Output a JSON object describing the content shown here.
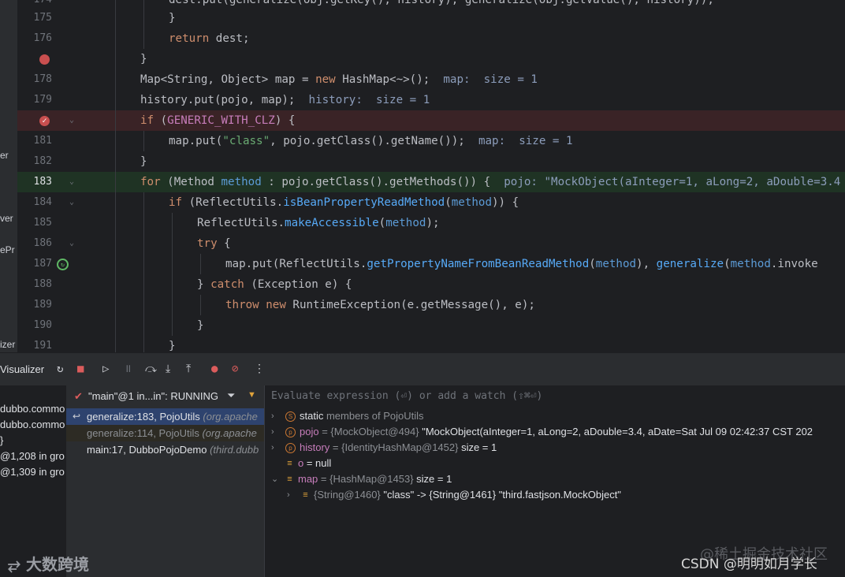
{
  "left_panel_fragments": [
    "er",
    "ver",
    "ePr",
    "izer"
  ],
  "editor": {
    "lines": [
      {
        "num": "174",
        "parts": [
          [
            "pl",
            "dest.put(generalize(obj.getKey(), history), generalize(obj.getValue(), history));"
          ]
        ]
      },
      {
        "num": "175",
        "parts": [
          [
            "pl",
            "}"
          ]
        ]
      },
      {
        "num": "176",
        "parts": [
          [
            "kw",
            "return "
          ],
          [
            "pl",
            "dest;"
          ]
        ]
      },
      {
        "num": "",
        "parts": [
          [
            "pl",
            "}"
          ]
        ]
      },
      {
        "num": "178",
        "parts": [
          [
            "pl",
            "Map<String, Object> map = "
          ],
          [
            "kw",
            "new "
          ],
          [
            "pl",
            "HashMap<~>();"
          ],
          [
            "inl",
            "  map:  size = 1"
          ]
        ]
      },
      {
        "num": "179",
        "parts": [
          [
            "pl",
            "history.put(pojo, map);"
          ],
          [
            "inl",
            "  history:  size = 1"
          ]
        ]
      },
      {
        "num": "",
        "parts": [
          [
            "kw",
            "if "
          ],
          [
            "pl",
            "("
          ],
          [
            "cst",
            "GENERIC_WITH_CLZ"
          ],
          [
            "pl",
            ") {"
          ]
        ]
      },
      {
        "num": "181",
        "parts": [
          [
            "pl",
            "map.put("
          ],
          [
            "str",
            "\"class\""
          ],
          [
            "pl",
            ", pojo.getClass().getName());"
          ],
          [
            "inl",
            "  map:  size = 1"
          ]
        ]
      },
      {
        "num": "182",
        "parts": [
          [
            "pl",
            "}"
          ]
        ]
      },
      {
        "num": "183",
        "parts": [
          [
            "kw",
            "for "
          ],
          [
            "pl",
            "(Method "
          ],
          [
            "param",
            "method"
          ],
          [
            "pl",
            " : pojo.getClass().getMethods()) {"
          ],
          [
            "inl",
            "  pojo: \"MockObject(aInteger=1, aLong=2, aDouble=3.4"
          ]
        ]
      },
      {
        "num": "184",
        "parts": [
          [
            "kw",
            "if "
          ],
          [
            "pl",
            "(ReflectUtils."
          ],
          [
            "fn",
            "isBeanPropertyReadMethod"
          ],
          [
            "pl",
            "("
          ],
          [
            "param",
            "method"
          ],
          [
            "pl",
            ")) {"
          ]
        ]
      },
      {
        "num": "185",
        "parts": [
          [
            "pl",
            "ReflectUtils."
          ],
          [
            "fn",
            "makeAccessible"
          ],
          [
            "pl",
            "("
          ],
          [
            "param",
            "method"
          ],
          [
            "pl",
            ");"
          ]
        ]
      },
      {
        "num": "186",
        "parts": [
          [
            "kw",
            "try "
          ],
          [
            "pl",
            "{"
          ]
        ]
      },
      {
        "num": "187",
        "parts": [
          [
            "pl",
            "map.put(ReflectUtils."
          ],
          [
            "fn",
            "getPropertyNameFromBeanReadMethod"
          ],
          [
            "pl",
            "("
          ],
          [
            "param",
            "method"
          ],
          [
            "pl",
            "), "
          ],
          [
            "fn",
            "generalize"
          ],
          [
            "pl",
            "("
          ],
          [
            "param",
            "method"
          ],
          [
            "pl",
            ".invoke"
          ]
        ]
      },
      {
        "num": "188",
        "parts": [
          [
            "pl",
            "} "
          ],
          [
            "kw",
            "catch "
          ],
          [
            "pl",
            "(Exception e) {"
          ]
        ]
      },
      {
        "num": "189",
        "parts": [
          [
            "kw",
            "throw new "
          ],
          [
            "pl",
            "RuntimeException(e.getMessage(), e);"
          ]
        ]
      },
      {
        "num": "190",
        "parts": [
          [
            "pl",
            "}"
          ]
        ]
      },
      {
        "num": "191",
        "parts": [
          [
            "pl",
            "}"
          ]
        ]
      }
    ]
  },
  "toolbar": {
    "title": "Visualizer",
    "icons": [
      "rerun-icon",
      "stop-icon",
      "resume-icon",
      "pause-icon",
      "step-over-icon",
      "step-into-icon",
      "step-out-icon",
      "view-breakpoints-icon",
      "mute-breakpoints-icon",
      "more-icon"
    ]
  },
  "left_list": [
    "dubbo.commo",
    "dubbo.commo",
    "}",
    "@1,208 in gro",
    "@1,309 in gro"
  ],
  "thread": {
    "label": "\"main\"@1 in...in\": RUNNING"
  },
  "frames": [
    {
      "text": "generalize:183, PojoUtils ",
      "pkg": "(org.apache",
      "selected": true
    },
    {
      "text": "generalize:114, PojoUtils ",
      "pkg": "(org.apache",
      "selected": false
    },
    {
      "text": "main:17, DubboPojoDemo ",
      "pkg": "(third.dubb",
      "selected": false
    }
  ],
  "evaluate_placeholder": "Evaluate expression (⏎) or add a watch (⇧⌘⏎)",
  "variables": [
    {
      "chev": "›",
      "icon": "S",
      "name": "static",
      "rest_type": " members of PojoUtils",
      "value": "",
      "plainname": true,
      "indent": 0
    },
    {
      "chev": "›",
      "icon": "p",
      "name": "pojo",
      "rest_type": " = {MockObject@494} ",
      "value": "\"MockObject(aInteger=1, aLong=2, aDouble=3.4, aDate=Sat Jul 09 02:42:37 CST 202",
      "plainname": false,
      "indent": 0
    },
    {
      "chev": "›",
      "icon": "p",
      "name": "history",
      "rest_type": " = {IdentityHashMap@1452} ",
      "value": " size = 1",
      "plainname": false,
      "indent": 0
    },
    {
      "chev": "",
      "icon": "≡",
      "name": "o",
      "rest_type": "",
      "value": " = null",
      "plainname": false,
      "indent": 0
    },
    {
      "chev": "⌄",
      "icon": "≡",
      "name": "map",
      "rest_type": " = {HashMap@1453} ",
      "value": " size = 1",
      "plainname": false,
      "indent": 0
    },
    {
      "chev": "›",
      "icon": "≡",
      "name": "",
      "rest_type": "{String@1460} ",
      "value": "\"class\" -> {String@1461} \"third.fastjson.MockObject\"",
      "plainname": false,
      "indent": 1
    }
  ],
  "watermark": {
    "left": "大数跨境",
    "right1": "@稀土掘金技术社区",
    "right2": "CSDN @明明如月学长"
  }
}
